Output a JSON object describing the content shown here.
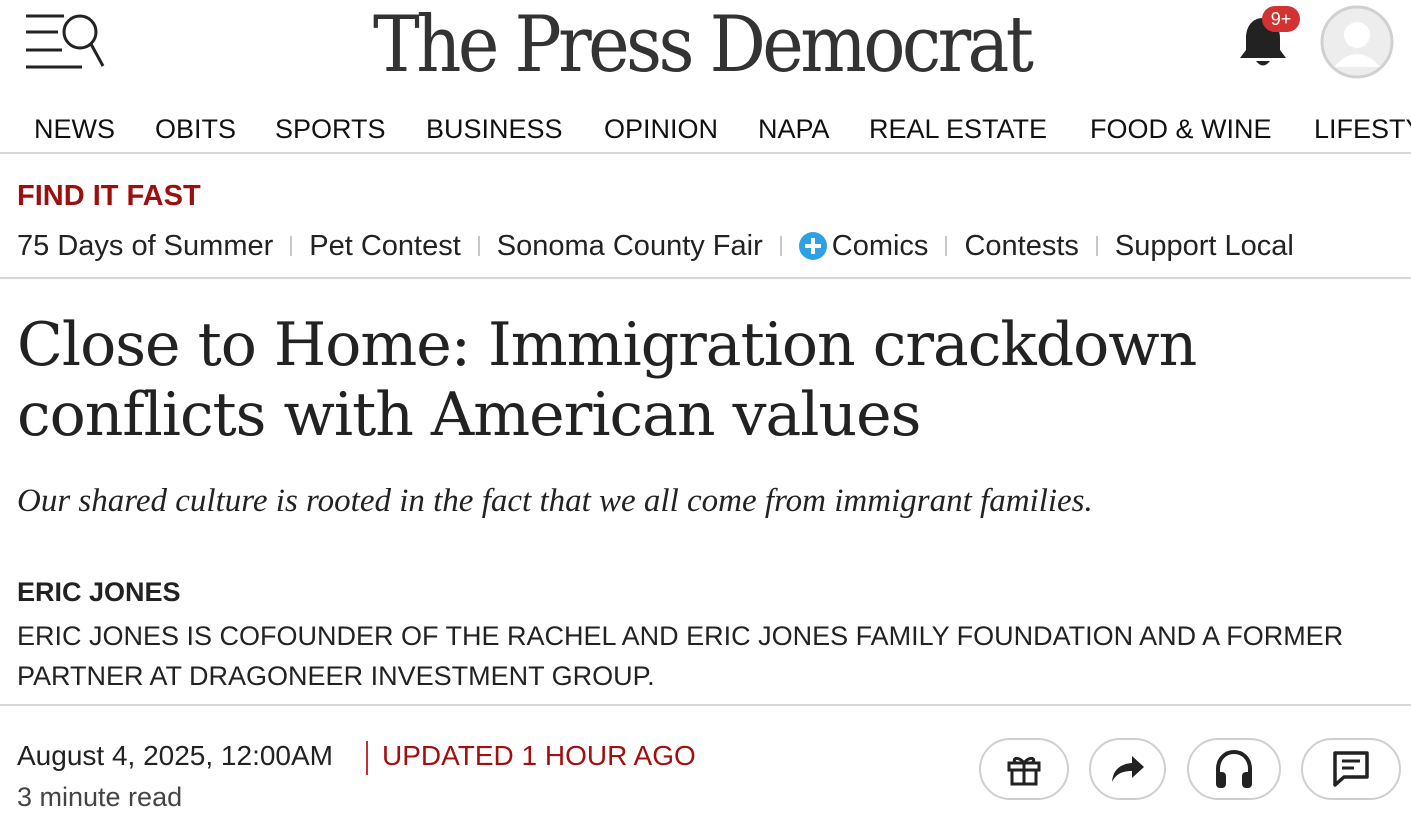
{
  "header": {
    "logo": "The Press Democrat",
    "notification_badge": "9+",
    "icons": [
      "menu-search-icon",
      "bell-icon",
      "user-avatar-icon"
    ]
  },
  "nav": {
    "items": [
      "NEWS",
      "OBITS",
      "SPORTS",
      "BUSINESS",
      "OPINION",
      "NAPA",
      "REAL ESTATE",
      "FOOD & WINE",
      "LIFESTYLE"
    ]
  },
  "find_it_fast": {
    "title": "FIND IT FAST",
    "links": [
      "75 Days of Summer",
      "Pet Contest",
      "Sonoma County Fair",
      "Comics",
      "Contests",
      "Support Local"
    ]
  },
  "article": {
    "headline": "Close to Home: Immigration crackdown conflicts with American values",
    "subhead": "Our shared culture is rooted in the fact that we all come from immigrant families.",
    "author": "ERIC JONES",
    "bio": "ERIC JONES IS COFOUNDER OF THE RACHEL AND ERIC JONES FAMILY FOUNDATION AND A FORMER PARTNER AT DRAGONEER INVESTMENT GROUP.",
    "date": "August 4, 2025, 12:00AM",
    "updated": "UPDATED 1 HOUR AGO",
    "read_time": "3 minute read"
  },
  "actions": [
    "gift-icon",
    "share-icon",
    "headphones-icon",
    "comment-icon"
  ],
  "colors": {
    "accent_red": "#9b0f0f",
    "badge_red": "#d23232",
    "comics_blue": "#2ea0e6"
  }
}
